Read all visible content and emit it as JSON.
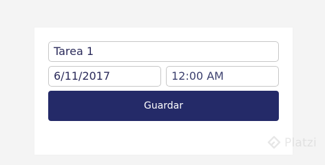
{
  "form": {
    "title_value": "Tarea 1",
    "date_value": "6/11/2017",
    "time_value": "12:00 AM",
    "save_label": "Guardar"
  },
  "watermark": {
    "brand": "Platzi"
  },
  "colors": {
    "button_bg": "#242a68",
    "page_bg": "#f4f4f4",
    "card_bg": "#ffffff",
    "input_border": "#c7c7c7",
    "input_text": "#2a2a5a",
    "watermark": "#bdbdbd"
  },
  "icons": {
    "watermark_logo": "platzi-logo-icon"
  }
}
